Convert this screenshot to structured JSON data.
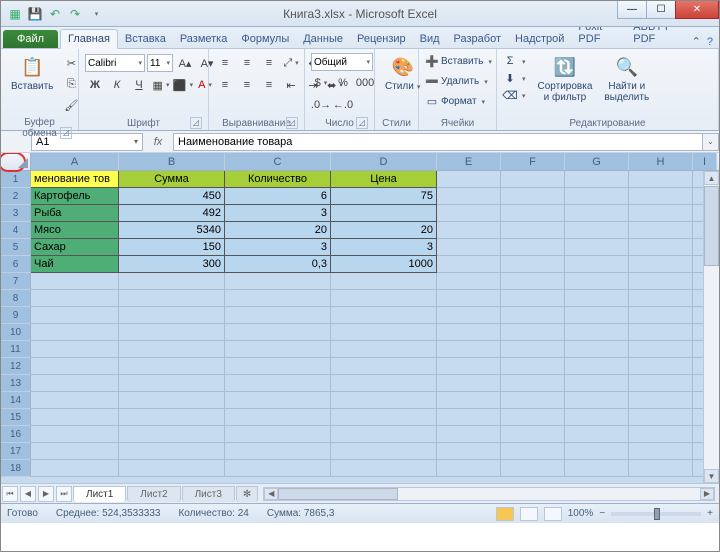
{
  "window": {
    "title": "Книга3.xlsx - Microsoft Excel"
  },
  "ribbon": {
    "file": "Файл",
    "tabs": [
      "Главная",
      "Вставка",
      "Разметка",
      "Формулы",
      "Данные",
      "Рецензир",
      "Вид",
      "Разработ",
      "Надстрой",
      "Foxit PDF",
      "ABBYY PDF"
    ],
    "active_tab": 0,
    "groups": {
      "clipboard": {
        "label": "Буфер обмена",
        "paste": "Вставить"
      },
      "font": {
        "label": "Шрифт",
        "name": "Calibri",
        "size": "11"
      },
      "alignment": {
        "label": "Выравнивание"
      },
      "number": {
        "label": "Число",
        "format": "Общий"
      },
      "styles": {
        "label": "Стили",
        "btn": "Стили"
      },
      "cells": {
        "label": "Ячейки",
        "insert": "Вставить",
        "delete": "Удалить",
        "format": "Формат"
      },
      "editing": {
        "label": "Редактирование",
        "sort": "Сортировка\nи фильтр",
        "find": "Найти и\nвыделить"
      }
    }
  },
  "namebox": "A1",
  "formula": "Наименование товара",
  "columns": [
    "A",
    "B",
    "C",
    "D",
    "E",
    "F",
    "G",
    "H",
    "I"
  ],
  "col_widths": [
    "wA",
    "wB",
    "wC",
    "wD",
    "wE",
    "wF",
    "wG",
    "wH",
    "wI"
  ],
  "row_count": 18,
  "table": {
    "headers": [
      "менование тов",
      "Сумма",
      "Количество",
      "Цена"
    ],
    "rows": [
      {
        "name": "Картофель",
        "sum": "450",
        "qty": "6",
        "price": "75"
      },
      {
        "name": "Рыба",
        "sum": "492",
        "qty": "3",
        "price": ""
      },
      {
        "name": "Мясо",
        "sum": "5340",
        "qty": "20",
        "price": "20"
      },
      {
        "name": "Сахар",
        "sum": "150",
        "qty": "3",
        "price": "3"
      },
      {
        "name": "Чай",
        "sum": "300",
        "qty": "0,3",
        "price": "1000"
      }
    ]
  },
  "sheets": [
    "Лист1",
    "Лист2",
    "Лист3"
  ],
  "status": {
    "ready": "Готово",
    "avg_label": "Среднее:",
    "avg": "524,3533333",
    "count_label": "Количество:",
    "count": "24",
    "sum_label": "Сумма:",
    "sum": "7865,3",
    "zoom": "100%"
  }
}
